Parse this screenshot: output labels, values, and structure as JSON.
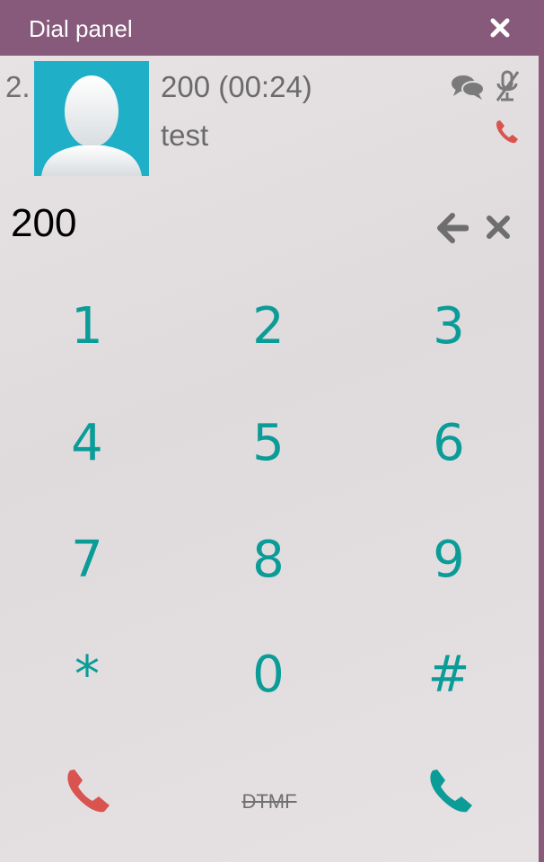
{
  "header": {
    "title": "Dial panel",
    "close_icon": "close-icon"
  },
  "call": {
    "index": "2.",
    "number": "200 (00:24)",
    "name": "test",
    "icons": [
      "chat-icon",
      "mic-muted-icon",
      "hangup-icon"
    ]
  },
  "dialer": {
    "value": "200",
    "icons": [
      "backspace-icon",
      "clear-icon"
    ]
  },
  "keypad": {
    "keys": [
      "1",
      "2",
      "3",
      "4",
      "5",
      "6",
      "7",
      "8",
      "9",
      "*",
      "0",
      "#"
    ]
  },
  "actions": {
    "dtmf_label": "DTMF",
    "hangup_icon": "hangup-icon",
    "call_icon": "phone-icon"
  },
  "colors": {
    "header_bg": "#875a7b",
    "avatar_bg": "#1fb0c8",
    "key_color": "#0b9c98",
    "hangup_color": "#d9534f",
    "call_color": "#0b9c98"
  }
}
